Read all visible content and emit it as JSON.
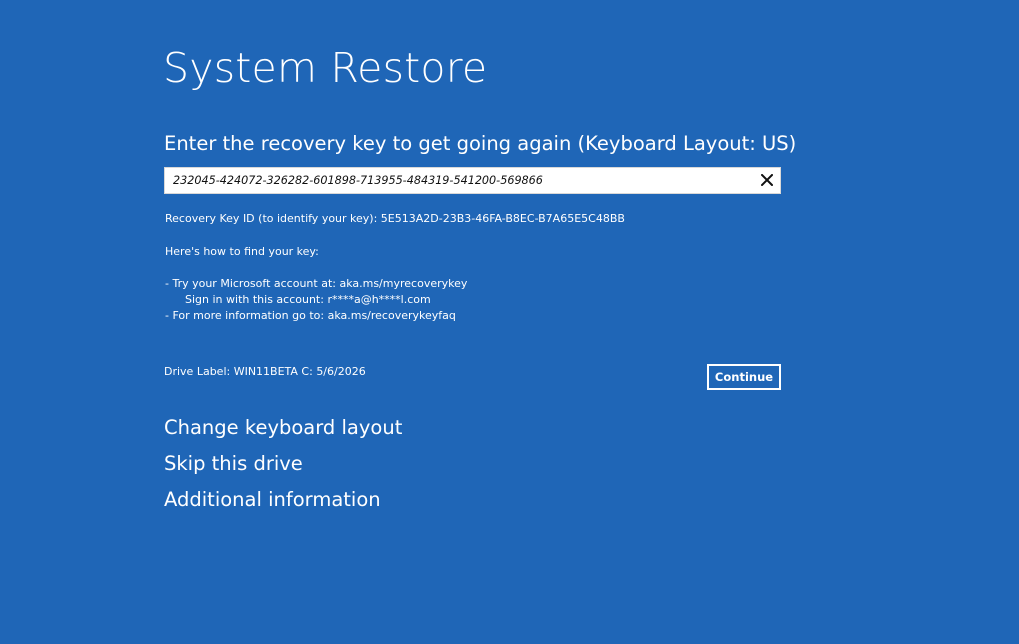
{
  "title": "System Restore",
  "prompt": "Enter the recovery key to get going again (Keyboard Layout: US)",
  "recovery_key_input": {
    "value": "232045-424072-326282-601898-713955-484319-541200-569866"
  },
  "clear_icon": "close-icon",
  "recovery_key_id_line": "Recovery Key ID (to identify your key): 5E513A2D-23B3-46FA-B8EC-B7A65E5C48BB",
  "find_key_heading": "Here's how to find your key:",
  "instructions": {
    "line1": "- Try your Microsoft account at: aka.ms/myrecoverykey",
    "line2": "Sign in with this account: r****a@h****l.com",
    "line3": "- For more information go to: aka.ms/recoverykeyfaq"
  },
  "drive_label": "Drive Label: WIN11BETA C: 5/6/2026",
  "continue_label": "Continue",
  "links": {
    "change_keyboard": "Change keyboard layout",
    "skip_drive": "Skip this drive",
    "additional_info": "Additional information"
  },
  "colors": {
    "background": "#1f66b7",
    "text": "#ffffff",
    "input_background": "#ffffff"
  }
}
